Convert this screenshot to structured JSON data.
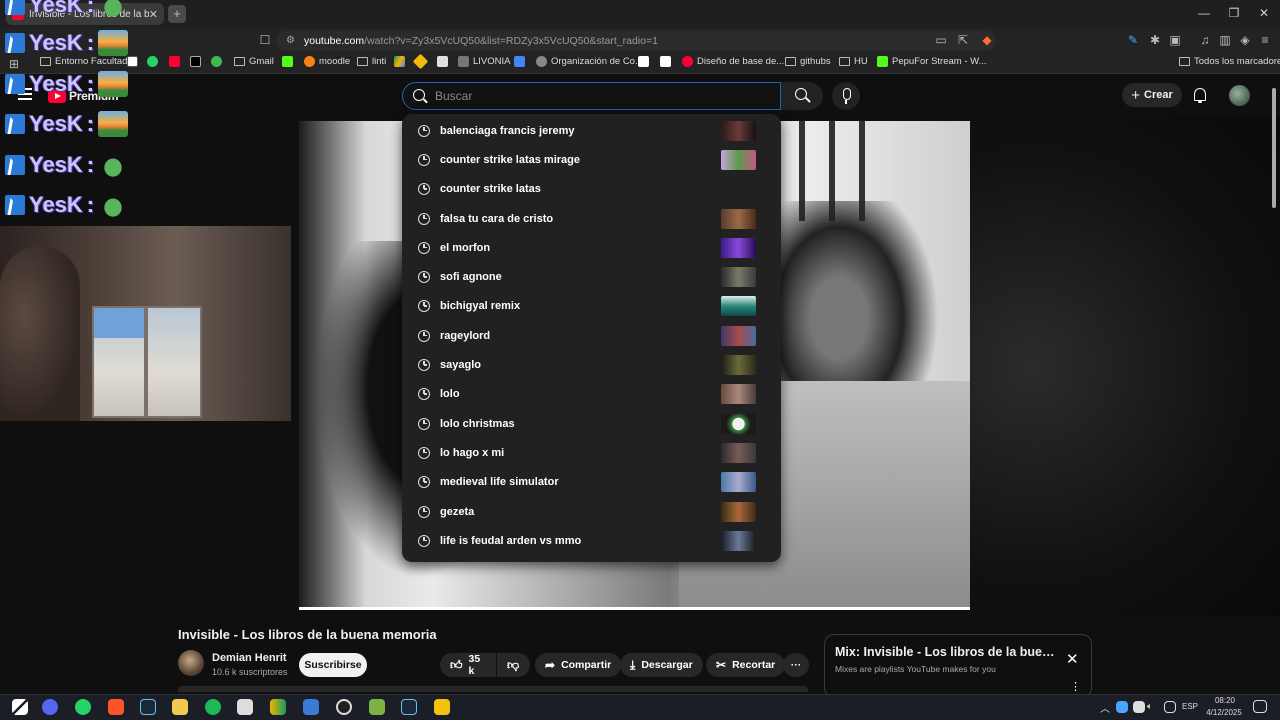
{
  "browser": {
    "tab_title": "Invisible - Los libros de la buena memoria",
    "tab_close": "✕",
    "new_tab": "+",
    "url_domain": "youtube.com",
    "url_path": "/watch?v=Zy3x5VcUQ50&list=RDZy3x5VcUQ50&start_radio=1",
    "win_min": "—",
    "win_max": "❐",
    "win_close": "✕"
  },
  "bookmarks": {
    "items": [
      "Entorno Facultad",
      "",
      "",
      "",
      "",
      "Gmail",
      "",
      "moodle",
      "linti",
      "",
      "",
      "LIVONIA",
      "",
      "Organización de Co...",
      "",
      "",
      "Diseño de base de...",
      "githubs",
      "HU",
      "PepuFor Stream - W..."
    ],
    "all": "Todos los marcadores"
  },
  "header": {
    "logo_text": "Premium",
    "search_placeholder": "Buscar",
    "create_label": "Crear"
  },
  "overlay": {
    "chat_name": "YesK",
    "chat_sep": ":"
  },
  "suggestions": [
    "balenciaga francis jeremy",
    "counter strike latas mirage",
    "counter strike latas",
    "falsa tu cara de cristo",
    "el morfon",
    "sofi agnone",
    "bichigyal remix",
    "rageylord",
    "sayaglo",
    "lolo",
    "lolo christmas",
    "lo hago x mi",
    "medieval life simulator",
    "gezeta",
    "life is feudal arden vs mmo"
  ],
  "video": {
    "title": "Invisible - Los libros de la buena memoria",
    "channel": "Demian Henrit",
    "subscribers": "10.6 k suscriptores",
    "subscribe": "Suscribirse",
    "likes": "35 k",
    "share": "Compartir",
    "download": "Descargar",
    "clip": "Recortar",
    "more": "···"
  },
  "mix": {
    "title": "Mix: Invisible - Los libros de la buen...",
    "subtitle": "Mixes are playlists YouTube makes for you",
    "close": "✕",
    "menu": "⋮"
  },
  "taskbar": {
    "lang": "ESP",
    "time": "08:20",
    "date": "4/12/2025"
  },
  "colors": {
    "accent_red": "#ff0033",
    "search_border": "#1c62b9",
    "dropdown_bg": "#212121"
  }
}
